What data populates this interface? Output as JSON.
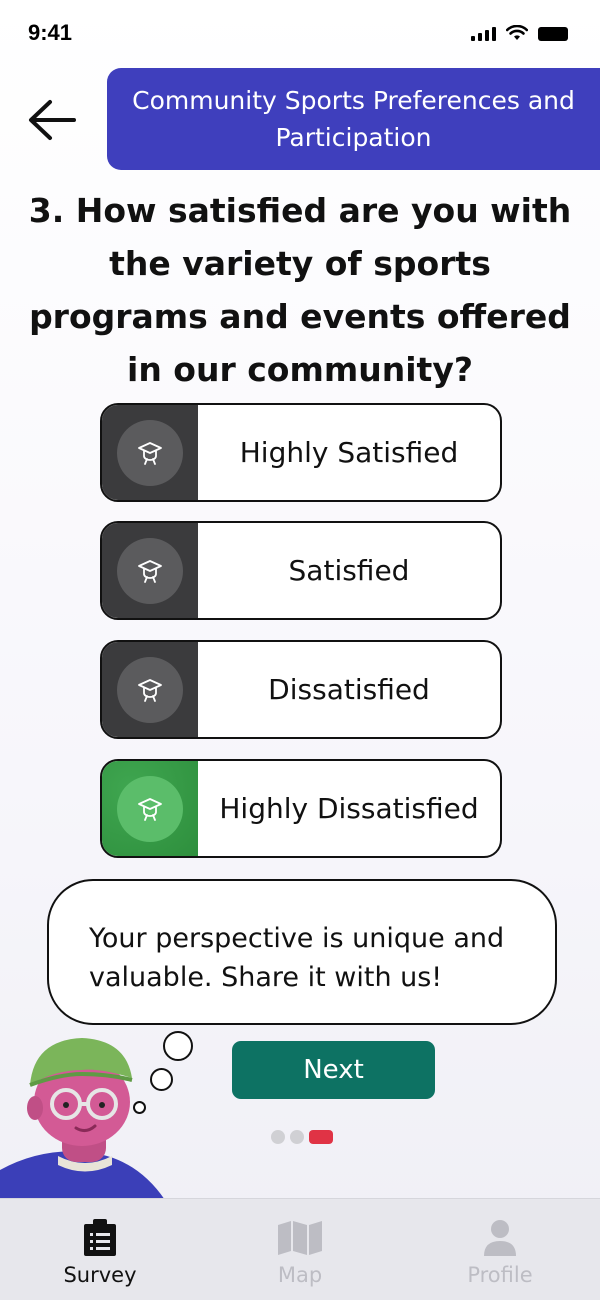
{
  "status_bar": {
    "time": "9:41"
  },
  "header": {
    "title": "Community Sports Preferences and Participation"
  },
  "question": {
    "text": "3. How satisfied are you with the variety of sports programs and events offered in our community?"
  },
  "options": [
    {
      "label": "Highly Satisfied",
      "selected": false,
      "icon": "graduation-cap-icon"
    },
    {
      "label": "Satisfied",
      "selected": false,
      "icon": "graduation-cap-icon"
    },
    {
      "label": "Dissatisfied",
      "selected": false,
      "icon": "graduation-cap-icon"
    },
    {
      "label": "Highly Dissatisfied",
      "selected": true,
      "icon": "graduation-cap-icon"
    }
  ],
  "speech_bubble": {
    "text": "Your perspective is unique and valuable. Share it with us!"
  },
  "next_button": {
    "label": "Next"
  },
  "pagination": {
    "total": 3,
    "current": 3
  },
  "tabs": [
    {
      "label": "Survey",
      "icon": "clipboard-icon",
      "active": true
    },
    {
      "label": "Map",
      "icon": "map-icon",
      "active": false
    },
    {
      "label": "Profile",
      "icon": "person-icon",
      "active": false
    }
  ],
  "colors": {
    "header": "#3f3fbd",
    "option_side": "#3b3b3d",
    "option_selected": "#2e8f3d",
    "next_button": "#0d7263",
    "active_dot": "#e03345",
    "inactive_tab": "#bdbdc4"
  }
}
